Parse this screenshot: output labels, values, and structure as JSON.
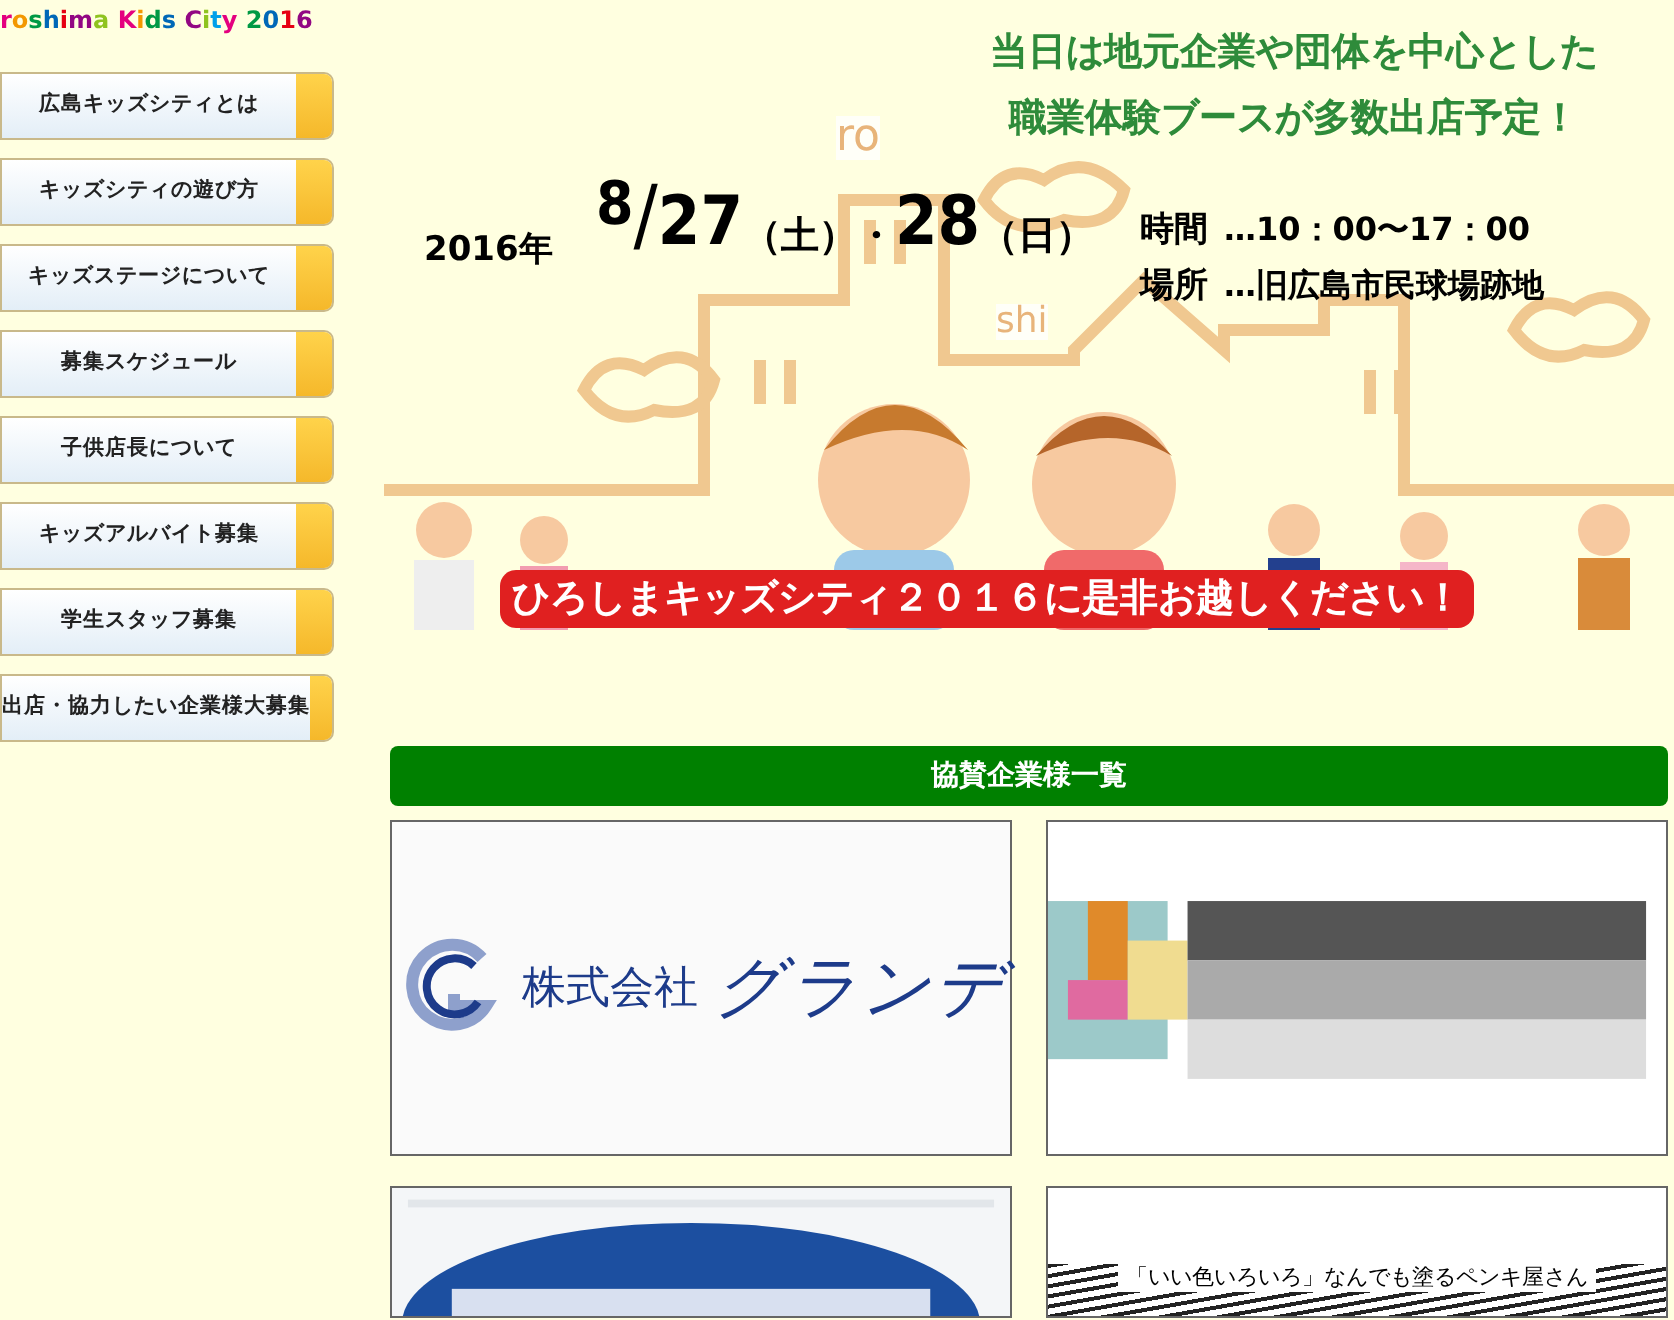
{
  "site_title": "roshima Kids City 2016",
  "nav": [
    {
      "label": "広島キッズシティとは"
    },
    {
      "label": "キッズシティの遊び方"
    },
    {
      "label": "キッズステージについて"
    },
    {
      "label": "募集スケジュール"
    },
    {
      "label": "子供店長について"
    },
    {
      "label": "キッズアルバイト募集"
    },
    {
      "label": "学生スタッフ募集"
    },
    {
      "label": "出店・協力したい企業様大募集"
    }
  ],
  "banner": {
    "headline": [
      "当日は地元企業や団体を中心とした",
      "職業体験ブースが多数出店予定！"
    ],
    "year": "2016年",
    "month": "8",
    "slash": "/",
    "day1": "27",
    "dow1": "（土）",
    "sep": "・",
    "day2": "28",
    "dow2": "（日）",
    "info": [
      {
        "label": "時間",
        "value": "…10：00〜17：00"
      },
      {
        "label": "場所",
        "value": "…旧広島市民球場跡地"
      }
    ],
    "decor": [
      "ro",
      "shi"
    ],
    "call": "ひろしまキッズシティ２０１６に是非お越しください！"
  },
  "sponsors": {
    "title": "協賛企業様一覧",
    "items": [
      {
        "kind": "logo",
        "company_type": "株式会社",
        "name": "グランデ"
      },
      {
        "kind": "picture"
      },
      {
        "kind": "picture"
      },
      {
        "kind": "caption",
        "caption": "「いい色いろいろ」なんでも塗るペンキ屋さん"
      }
    ]
  }
}
